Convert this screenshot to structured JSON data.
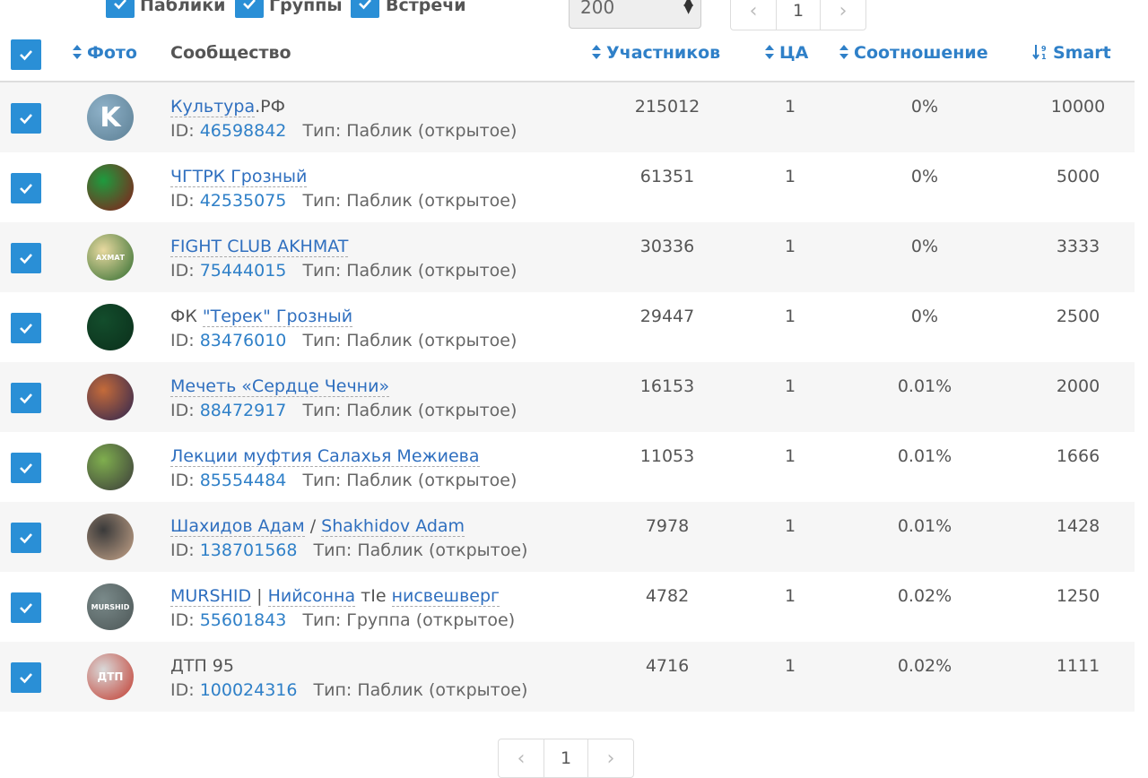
{
  "filters": [
    {
      "label": "Паблики",
      "checked": true
    },
    {
      "label": "Группы",
      "checked": true
    },
    {
      "label": "Встречи",
      "checked": true
    }
  ],
  "per_page": "200",
  "top_pager": {
    "prev": "‹",
    "current": "1",
    "next": "›"
  },
  "bottom_pager": {
    "prev": "‹",
    "current": "1",
    "next": "›"
  },
  "headers": {
    "photo": "Фото",
    "community": "Сообщество",
    "members": "Участников",
    "ca": "ЦА",
    "ratio": "Соотношение",
    "smart": "Smart"
  },
  "rows": [
    {
      "name_link": "Культура",
      "name_rest": ".РФ",
      "id_label": "ID:",
      "id": "46598842",
      "type": "Тип: Паблик (открытое)",
      "members": "215012",
      "ca": "1",
      "ratio": "0%",
      "smart": "10000"
    },
    {
      "name_link": "ЧГТРК Грозный",
      "name_rest": "",
      "id_label": "ID:",
      "id": "42535075",
      "type": "Тип: Паблик (открытое)",
      "members": "61351",
      "ca": "1",
      "ratio": "0%",
      "smart": "5000"
    },
    {
      "name_link": "FIGHT CLUB AKHMAT",
      "name_rest": "",
      "id_label": "ID:",
      "id": "75444015",
      "type": "Тип: Паблик (открытое)",
      "members": "30336",
      "ca": "1",
      "ratio": "0%",
      "smart": "3333"
    },
    {
      "name_prefix": "ФК ",
      "name_link": "\"Терек\" Грозный",
      "id_label": "ID:",
      "id": "83476010",
      "type": "Тип: Паблик (открытое)",
      "members": "29447",
      "ca": "1",
      "ratio": "0%",
      "smart": "2500"
    },
    {
      "name_link": "Мечеть «Сердце Чечни»",
      "name_rest": "",
      "id_label": "ID:",
      "id": "88472917",
      "type": "Тип: Паблик (открытое)",
      "members": "16153",
      "ca": "1",
      "ratio": "0.01%",
      "smart": "2000"
    },
    {
      "name_link": "Лекции муфтия Салахья Межиева",
      "name_rest": "",
      "id_label": "ID:",
      "id": "85554484",
      "type": "Тип: Паблик (открытое)",
      "members": "11053",
      "ca": "1",
      "ratio": "0.01%",
      "smart": "1666"
    },
    {
      "name_link": "Шахидов Адам",
      "name_sep": " / ",
      "name_link2": "Shakhidov Adam",
      "id_label": "ID:",
      "id": "138701568",
      "type": "Тип: Паблик (открытое)",
      "members": "7978",
      "ca": "1",
      "ratio": "0.01%",
      "smart": "1428"
    },
    {
      "name_link": "MURSHID",
      "name_sep": " | ",
      "name_link2": "Нийсонна",
      "name_sep2": " тIе ",
      "name_link3": "нисвешверг",
      "id_label": "ID:",
      "id": "55601843",
      "type": "Тип: Группа (открытое)",
      "members": "4782",
      "ca": "1",
      "ratio": "0.02%",
      "smart": "1250"
    },
    {
      "name_plain": "ДТП 95",
      "id_label": "ID:",
      "id": "100024316",
      "type": "Тип: Паблик (открытое)",
      "members": "4716",
      "ca": "1",
      "ratio": "0.02%",
      "smart": "1111"
    }
  ],
  "avatars": [
    {
      "icon": "kultura-logo-icon",
      "text": "K",
      "colors": [
        "#8fb2c9",
        "#5c7f94"
      ]
    },
    {
      "icon": "chgtrk-logo-icon",
      "text": "",
      "colors": [
        "#1e9b3e",
        "#8a1a1a"
      ]
    },
    {
      "icon": "akhmat-fight-club-logo-icon",
      "text": "АХМАТ",
      "colors": [
        "#e8d9a0",
        "#2e6b2e"
      ]
    },
    {
      "icon": "terek-logo-icon",
      "text": "",
      "colors": [
        "#134d2c",
        "#0b2f1b"
      ]
    },
    {
      "icon": "mosque-photo-icon",
      "text": "",
      "colors": [
        "#c46b3a",
        "#2c2450"
      ]
    },
    {
      "icon": "person-photo-icon",
      "text": "",
      "colors": [
        "#7fae4e",
        "#3a3a3a"
      ]
    },
    {
      "icon": "two-people-photo-icon",
      "text": "",
      "colors": [
        "#3a3a3a",
        "#c7a58a"
      ]
    },
    {
      "icon": "murshid-logo-icon",
      "text": "MURSHID",
      "colors": [
        "#7a8a8a",
        "#4c5656"
      ]
    },
    {
      "icon": "dtp-warning-icon",
      "text": "ДТП",
      "colors": [
        "#d9d9d9",
        "#c23a2e"
      ]
    }
  ]
}
